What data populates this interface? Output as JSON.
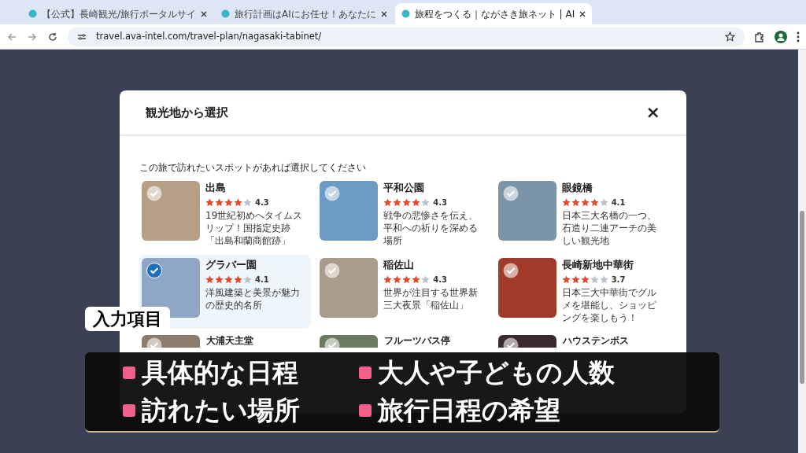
{
  "browser": {
    "tabs": [
      {
        "title": "【公式】長崎観光/旅行ポータルサイ",
        "selected": false
      },
      {
        "title": "旅行計画はAIにお任せ！あなたに",
        "selected": false
      },
      {
        "title": "旅程をつくる｜ながさき旅ネット | AI",
        "selected": true
      }
    ],
    "url": "travel.ava-intel.com/travel-plan/nagasaki-tabinet/"
  },
  "modal": {
    "title": "観光地から選択",
    "close": "×",
    "prompt": "この旅で訪れたいスポットがあれば選択してください",
    "spots": [
      {
        "name": "出島",
        "stars": 4,
        "rating": "4.3",
        "description": "19世紀初めへタイムスリップ！国指定史跡「出島和蘭商館跡」",
        "selected": false
      },
      {
        "name": "平和公園",
        "stars": 4,
        "rating": "4.3",
        "description": "戦争の悲惨さを伝え、平和への祈りを深める場所",
        "selected": false
      },
      {
        "name": "眼鏡橋",
        "stars": 4,
        "rating": "4.1",
        "description": "日本三大名橋の一つ、石造り二連アーチの美しい観光地",
        "selected": false
      },
      {
        "name": "グラバー園",
        "stars": 4,
        "rating": "4.1",
        "description": "洋風建築と美景が魅力の歴史的名所",
        "selected": true
      },
      {
        "name": "稲佐山",
        "stars": 4,
        "rating": "4.3",
        "description": "世界が注目する世界新三大夜景「稲佐山」",
        "selected": false
      },
      {
        "name": "長崎新地中華街",
        "stars": 3,
        "rating": "3.7",
        "description": "日本三大中華街でグルメを堪能し、ショッピングを楽しもう！",
        "selected": false
      },
      {
        "name": "大浦天主堂",
        "selected": false
      },
      {
        "name": "フルーツバス停",
        "selected": false
      },
      {
        "name": "ハウステンボス",
        "selected": false
      }
    ]
  },
  "caption": {
    "label": "入力項目",
    "items": [
      "具体的な日程",
      "大人や子どもの人数",
      "訪れたい場所",
      "旅行日程の希望"
    ]
  }
}
